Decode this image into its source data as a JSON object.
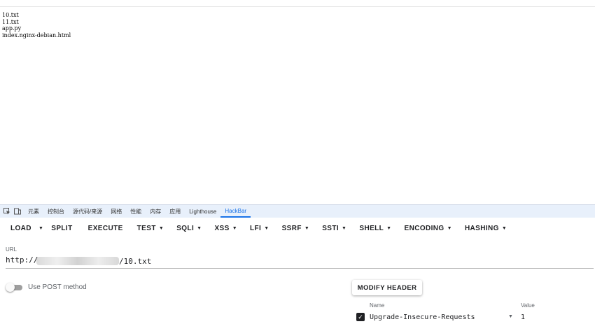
{
  "page": {
    "files": [
      "10.txt",
      "11.txt",
      "app.py",
      "index.nginx-debian.html"
    ]
  },
  "devtools": {
    "tabs": [
      "元素",
      "控制台",
      "源代码/来源",
      "网络",
      "性能",
      "内存",
      "应用",
      "Lighthouse",
      "HackBar"
    ],
    "active_tab": "HackBar"
  },
  "hackbar": {
    "toolbar": {
      "load": "LOAD",
      "split": "SPLIT",
      "execute": "EXECUTE",
      "test": "TEST",
      "sqli": "SQLI",
      "xss": "XSS",
      "lfi": "LFI",
      "ssrf": "SSRF",
      "ssti": "SSTI",
      "shell": "SHELL",
      "encoding": "ENCODING",
      "hashing": "HASHING"
    },
    "url_label": "URL",
    "url_prefix": "http://",
    "url_suffix": "/10.txt",
    "post_label": "Use POST method",
    "post_enabled": false,
    "modify_header": "MODIFY HEADER",
    "header": {
      "name_label": "Name",
      "value_label": "Value",
      "name": "Upgrade-Insecure-Requests",
      "value": "1",
      "enabled": true
    }
  },
  "colors": {
    "accent": "#1a73e8",
    "devtools_tab_bg": "#e8f0fb"
  },
  "icons": [
    "inspect-element-icon",
    "device-toolbar-icon",
    "caret-down-icon",
    "checkbox-checked-icon"
  ]
}
